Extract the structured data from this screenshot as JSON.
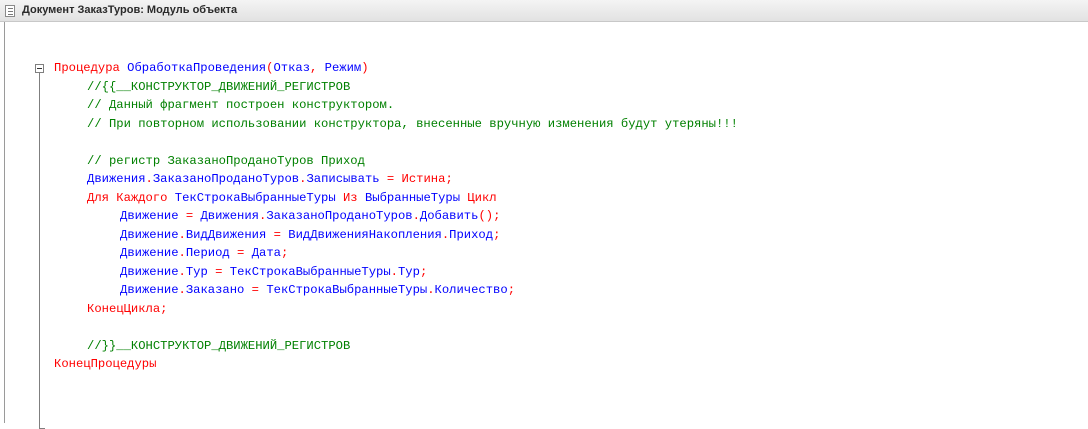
{
  "window": {
    "title": "Документ ЗаказТуров: Модуль объекта",
    "icon": "module-document-icon"
  },
  "code": {
    "lines": [
      {
        "indent": 0,
        "tokens": [
          {
            "t": "kw",
            "v": "Процедура "
          },
          {
            "t": "id",
            "v": "ОбработкаПроведения"
          },
          {
            "t": "kw",
            "v": "("
          },
          {
            "t": "id",
            "v": "Отказ"
          },
          {
            "t": "kw",
            "v": ", "
          },
          {
            "t": "id",
            "v": "Режим"
          },
          {
            "t": "kw",
            "v": ")"
          }
        ]
      },
      {
        "indent": 1,
        "tokens": [
          {
            "t": "cm",
            "v": "//{{__КОНСТРУКТОР_ДВИЖЕНИЙ_РЕГИСТРОВ"
          }
        ]
      },
      {
        "indent": 1,
        "tokens": [
          {
            "t": "cm",
            "v": "// Данный фрагмент построен конструктором."
          }
        ]
      },
      {
        "indent": 1,
        "tokens": [
          {
            "t": "cm",
            "v": "// При повторном использовании конструктора, внесенные вручную изменения будут утеряны!!!"
          }
        ]
      },
      {
        "indent": 0,
        "tokens": []
      },
      {
        "indent": 1,
        "tokens": [
          {
            "t": "cm",
            "v": "// регистр ЗаказаноПроданоТуров Приход"
          }
        ]
      },
      {
        "indent": 1,
        "tokens": [
          {
            "t": "id",
            "v": "Движения"
          },
          {
            "t": "kw",
            "v": "."
          },
          {
            "t": "id",
            "v": "ЗаказаноПроданоТуров"
          },
          {
            "t": "kw",
            "v": "."
          },
          {
            "t": "id",
            "v": "Записывать"
          },
          {
            "t": "kw",
            "v": " = "
          },
          {
            "t": "kw",
            "v": "Истина"
          },
          {
            "t": "kw",
            "v": ";"
          }
        ]
      },
      {
        "indent": 1,
        "tokens": [
          {
            "t": "kw",
            "v": "Для Каждого "
          },
          {
            "t": "id",
            "v": "ТекСтрокаВыбранныеТуры"
          },
          {
            "t": "kw",
            "v": " Из "
          },
          {
            "t": "id",
            "v": "ВыбранныеТуры"
          },
          {
            "t": "kw",
            "v": " Цикл"
          }
        ]
      },
      {
        "indent": 2,
        "tokens": [
          {
            "t": "id",
            "v": "Движение"
          },
          {
            "t": "kw",
            "v": " = "
          },
          {
            "t": "id",
            "v": "Движения"
          },
          {
            "t": "kw",
            "v": "."
          },
          {
            "t": "id",
            "v": "ЗаказаноПроданоТуров"
          },
          {
            "t": "kw",
            "v": "."
          },
          {
            "t": "id",
            "v": "Добавить"
          },
          {
            "t": "kw",
            "v": "();"
          }
        ]
      },
      {
        "indent": 2,
        "tokens": [
          {
            "t": "id",
            "v": "Движение"
          },
          {
            "t": "kw",
            "v": "."
          },
          {
            "t": "id",
            "v": "ВидДвижения"
          },
          {
            "t": "kw",
            "v": " = "
          },
          {
            "t": "id",
            "v": "ВидДвиженияНакопления"
          },
          {
            "t": "kw",
            "v": "."
          },
          {
            "t": "id",
            "v": "Приход"
          },
          {
            "t": "kw",
            "v": ";"
          }
        ]
      },
      {
        "indent": 2,
        "tokens": [
          {
            "t": "id",
            "v": "Движение"
          },
          {
            "t": "kw",
            "v": "."
          },
          {
            "t": "id",
            "v": "Период"
          },
          {
            "t": "kw",
            "v": " = "
          },
          {
            "t": "id",
            "v": "Дата"
          },
          {
            "t": "kw",
            "v": ";"
          }
        ]
      },
      {
        "indent": 2,
        "tokens": [
          {
            "t": "id",
            "v": "Движение"
          },
          {
            "t": "kw",
            "v": "."
          },
          {
            "t": "id",
            "v": "Тур"
          },
          {
            "t": "kw",
            "v": " = "
          },
          {
            "t": "id",
            "v": "ТекСтрокаВыбранныеТуры"
          },
          {
            "t": "kw",
            "v": "."
          },
          {
            "t": "id",
            "v": "Тур"
          },
          {
            "t": "kw",
            "v": ";"
          }
        ]
      },
      {
        "indent": 2,
        "tokens": [
          {
            "t": "id",
            "v": "Движение"
          },
          {
            "t": "kw",
            "v": "."
          },
          {
            "t": "id",
            "v": "Заказано"
          },
          {
            "t": "kw",
            "v": " = "
          },
          {
            "t": "id",
            "v": "ТекСтрокаВыбранныеТуры"
          },
          {
            "t": "kw",
            "v": "."
          },
          {
            "t": "id",
            "v": "Количество"
          },
          {
            "t": "kw",
            "v": ";"
          }
        ]
      },
      {
        "indent": 1,
        "tokens": [
          {
            "t": "kw",
            "v": "КонецЦикла;"
          }
        ]
      },
      {
        "indent": 0,
        "tokens": []
      },
      {
        "indent": 1,
        "tokens": [
          {
            "t": "cm",
            "v": "//}}__КОНСТРУКТОР_ДВИЖЕНИЙ_РЕГИСТРОВ"
          }
        ]
      },
      {
        "indent": 0,
        "tokens": [
          {
            "t": "kw",
            "v": "КонецПроцедуры"
          }
        ]
      }
    ]
  },
  "colors": {
    "keyword": "#ff0000",
    "identifier": "#0000ff",
    "comment": "#008000"
  }
}
